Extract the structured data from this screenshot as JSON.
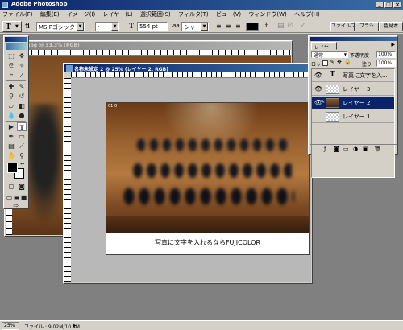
{
  "app": {
    "title": "Adobe Photoshop"
  },
  "menu": [
    "ファイル(F)",
    "編集(E)",
    "イメージ(I)",
    "レイヤー(L)",
    "選択範囲(S)",
    "フィルタ(T)",
    "ビュー(V)",
    "ウィンドウ(W)",
    "ヘルプ(H)"
  ],
  "window_controls": {
    "minimize": "_",
    "maximize": "□",
    "close": "×"
  },
  "options_bar": {
    "tool_icon": "T",
    "font_family": "MS Pゴシック",
    "font_style": "-",
    "font_size": "554 pt",
    "anti_alias_label": "aa",
    "anti_alias": "シャープ",
    "palette_tabs": [
      "ファイルブ",
      "ブラシ",
      "色見本"
    ]
  },
  "bg_doc": {
    "title": "1.jpg @ 33.3% (RGB)"
  },
  "doc": {
    "title": "名称未設定 2 @ 25% (レイヤー 2, RGB)",
    "photo_label": "01 0",
    "caption": "写真に文字を入れるならFUJICOLOR"
  },
  "layers": {
    "title": "レイヤー",
    "blend_mode": "通常",
    "opacity_label": "不透明度",
    "opacity": "100%",
    "lock_label": "ロック",
    "fill_label": "塗り",
    "fill": "100%",
    "rows": [
      {
        "name": "写真に文字を入...",
        "thumb": "T",
        "selected": false
      },
      {
        "name": "レイヤー 3",
        "thumb": "",
        "selected": false
      },
      {
        "name": "レイヤー 2",
        "thumb": "img",
        "selected": true
      },
      {
        "name": "レイヤー 1",
        "thumb": "",
        "selected": false
      }
    ]
  },
  "status": {
    "zoom": "25%",
    "info": "ファイル : 9.02M/10.4M"
  },
  "colors": {
    "title_active": "#0a246a",
    "panel": "#d4d0c8",
    "workspace": "#808080"
  }
}
